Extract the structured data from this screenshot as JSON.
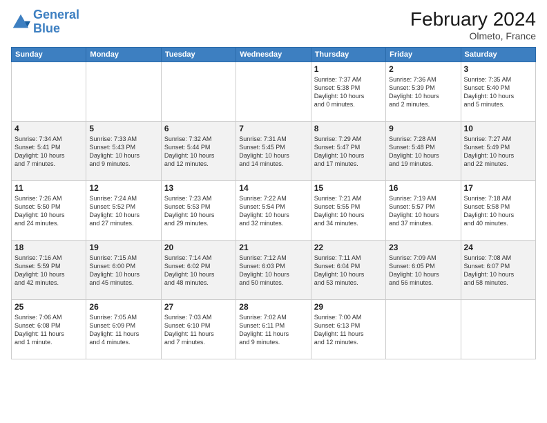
{
  "logo": {
    "line1": "General",
    "line2": "Blue"
  },
  "title": "February 2024",
  "subtitle": "Olmeto, France",
  "weekdays": [
    "Sunday",
    "Monday",
    "Tuesday",
    "Wednesday",
    "Thursday",
    "Friday",
    "Saturday"
  ],
  "weeks": [
    [
      {
        "day": "",
        "info": ""
      },
      {
        "day": "",
        "info": ""
      },
      {
        "day": "",
        "info": ""
      },
      {
        "day": "",
        "info": ""
      },
      {
        "day": "1",
        "info": "Sunrise: 7:37 AM\nSunset: 5:38 PM\nDaylight: 10 hours\nand 0 minutes."
      },
      {
        "day": "2",
        "info": "Sunrise: 7:36 AM\nSunset: 5:39 PM\nDaylight: 10 hours\nand 2 minutes."
      },
      {
        "day": "3",
        "info": "Sunrise: 7:35 AM\nSunset: 5:40 PM\nDaylight: 10 hours\nand 5 minutes."
      }
    ],
    [
      {
        "day": "4",
        "info": "Sunrise: 7:34 AM\nSunset: 5:41 PM\nDaylight: 10 hours\nand 7 minutes."
      },
      {
        "day": "5",
        "info": "Sunrise: 7:33 AM\nSunset: 5:43 PM\nDaylight: 10 hours\nand 9 minutes."
      },
      {
        "day": "6",
        "info": "Sunrise: 7:32 AM\nSunset: 5:44 PM\nDaylight: 10 hours\nand 12 minutes."
      },
      {
        "day": "7",
        "info": "Sunrise: 7:31 AM\nSunset: 5:45 PM\nDaylight: 10 hours\nand 14 minutes."
      },
      {
        "day": "8",
        "info": "Sunrise: 7:29 AM\nSunset: 5:47 PM\nDaylight: 10 hours\nand 17 minutes."
      },
      {
        "day": "9",
        "info": "Sunrise: 7:28 AM\nSunset: 5:48 PM\nDaylight: 10 hours\nand 19 minutes."
      },
      {
        "day": "10",
        "info": "Sunrise: 7:27 AM\nSunset: 5:49 PM\nDaylight: 10 hours\nand 22 minutes."
      }
    ],
    [
      {
        "day": "11",
        "info": "Sunrise: 7:26 AM\nSunset: 5:50 PM\nDaylight: 10 hours\nand 24 minutes."
      },
      {
        "day": "12",
        "info": "Sunrise: 7:24 AM\nSunset: 5:52 PM\nDaylight: 10 hours\nand 27 minutes."
      },
      {
        "day": "13",
        "info": "Sunrise: 7:23 AM\nSunset: 5:53 PM\nDaylight: 10 hours\nand 29 minutes."
      },
      {
        "day": "14",
        "info": "Sunrise: 7:22 AM\nSunset: 5:54 PM\nDaylight: 10 hours\nand 32 minutes."
      },
      {
        "day": "15",
        "info": "Sunrise: 7:21 AM\nSunset: 5:55 PM\nDaylight: 10 hours\nand 34 minutes."
      },
      {
        "day": "16",
        "info": "Sunrise: 7:19 AM\nSunset: 5:57 PM\nDaylight: 10 hours\nand 37 minutes."
      },
      {
        "day": "17",
        "info": "Sunrise: 7:18 AM\nSunset: 5:58 PM\nDaylight: 10 hours\nand 40 minutes."
      }
    ],
    [
      {
        "day": "18",
        "info": "Sunrise: 7:16 AM\nSunset: 5:59 PM\nDaylight: 10 hours\nand 42 minutes."
      },
      {
        "day": "19",
        "info": "Sunrise: 7:15 AM\nSunset: 6:00 PM\nDaylight: 10 hours\nand 45 minutes."
      },
      {
        "day": "20",
        "info": "Sunrise: 7:14 AM\nSunset: 6:02 PM\nDaylight: 10 hours\nand 48 minutes."
      },
      {
        "day": "21",
        "info": "Sunrise: 7:12 AM\nSunset: 6:03 PM\nDaylight: 10 hours\nand 50 minutes."
      },
      {
        "day": "22",
        "info": "Sunrise: 7:11 AM\nSunset: 6:04 PM\nDaylight: 10 hours\nand 53 minutes."
      },
      {
        "day": "23",
        "info": "Sunrise: 7:09 AM\nSunset: 6:05 PM\nDaylight: 10 hours\nand 56 minutes."
      },
      {
        "day": "24",
        "info": "Sunrise: 7:08 AM\nSunset: 6:07 PM\nDaylight: 10 hours\nand 58 minutes."
      }
    ],
    [
      {
        "day": "25",
        "info": "Sunrise: 7:06 AM\nSunset: 6:08 PM\nDaylight: 11 hours\nand 1 minute."
      },
      {
        "day": "26",
        "info": "Sunrise: 7:05 AM\nSunset: 6:09 PM\nDaylight: 11 hours\nand 4 minutes."
      },
      {
        "day": "27",
        "info": "Sunrise: 7:03 AM\nSunset: 6:10 PM\nDaylight: 11 hours\nand 7 minutes."
      },
      {
        "day": "28",
        "info": "Sunrise: 7:02 AM\nSunset: 6:11 PM\nDaylight: 11 hours\nand 9 minutes."
      },
      {
        "day": "29",
        "info": "Sunrise: 7:00 AM\nSunset: 6:13 PM\nDaylight: 11 hours\nand 12 minutes."
      },
      {
        "day": "",
        "info": ""
      },
      {
        "day": "",
        "info": ""
      }
    ]
  ]
}
